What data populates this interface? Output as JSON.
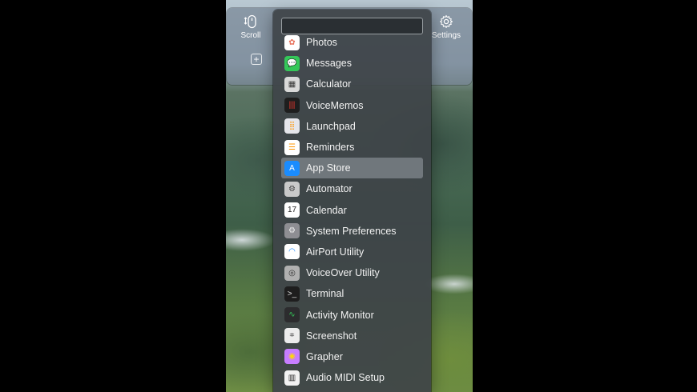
{
  "toolbar": {
    "scroll_label": "Scroll",
    "settings_label": "Settings",
    "add_symbol": "+"
  },
  "search": {
    "value": "",
    "placeholder": ""
  },
  "apps": [
    {
      "name": "Photos",
      "icon": "photos-icon",
      "bg": "#ffffff",
      "glyph": "✿",
      "fg": "#e8705a"
    },
    {
      "name": "Messages",
      "icon": "messages-icon",
      "bg": "#34c759",
      "glyph": "💬",
      "fg": "#ffffff"
    },
    {
      "name": "Calculator",
      "icon": "calculator-icon",
      "bg": "#d9d9d9",
      "glyph": "▦",
      "fg": "#333333"
    },
    {
      "name": "VoiceMemos",
      "icon": "voice-memos-icon",
      "bg": "#1e1e1e",
      "glyph": "|||",
      "fg": "#ff3b30"
    },
    {
      "name": "Launchpad",
      "icon": "launchpad-icon",
      "bg": "#e5e5ea",
      "glyph": "⣿",
      "fg": "#ff9500"
    },
    {
      "name": "Reminders",
      "icon": "reminders-icon",
      "bg": "#ffffff",
      "glyph": "☰",
      "fg": "#ff9500"
    },
    {
      "name": "App Store",
      "icon": "app-store-icon",
      "bg": "#1a8cff",
      "glyph": "A",
      "fg": "#ffffff"
    },
    {
      "name": "Automator",
      "icon": "automator-icon",
      "bg": "#c9c9c9",
      "glyph": "⚙",
      "fg": "#444444"
    },
    {
      "name": "Calendar",
      "icon": "calendar-icon",
      "bg": "#ffffff",
      "glyph": "17",
      "fg": "#222222"
    },
    {
      "name": "System Preferences",
      "icon": "system-preferences-icon",
      "bg": "#8e8e93",
      "glyph": "⚙",
      "fg": "#eeeeee"
    },
    {
      "name": "AirPort Utility",
      "icon": "airport-utility-icon",
      "bg": "#ffffff",
      "glyph": "◠",
      "fg": "#1a8cff"
    },
    {
      "name": "VoiceOver Utility",
      "icon": "voiceover-utility-icon",
      "bg": "#b0b0b0",
      "glyph": "◎",
      "fg": "#333333"
    },
    {
      "name": "Terminal",
      "icon": "terminal-icon",
      "bg": "#1e1e1e",
      "glyph": ">_",
      "fg": "#dddddd"
    },
    {
      "name": "Activity Monitor",
      "icon": "activity-monitor-icon",
      "bg": "#2c2c2e",
      "glyph": "∿",
      "fg": "#34c759"
    },
    {
      "name": "Screenshot",
      "icon": "screenshot-icon",
      "bg": "#ececec",
      "glyph": "⌗",
      "fg": "#333333"
    },
    {
      "name": "Grapher",
      "icon": "grapher-icon",
      "bg": "#c77dff",
      "glyph": "◉",
      "fg": "#ffd60a"
    },
    {
      "name": "Audio MIDI Setup",
      "icon": "audio-midi-setup-icon",
      "bg": "#f2f2f2",
      "glyph": "▥",
      "fg": "#222222"
    }
  ],
  "selected_app": "App Store",
  "colors": {
    "popup_bg": "#3e4448",
    "selection": "#82888e",
    "toolbar_bg": "#78879a"
  }
}
